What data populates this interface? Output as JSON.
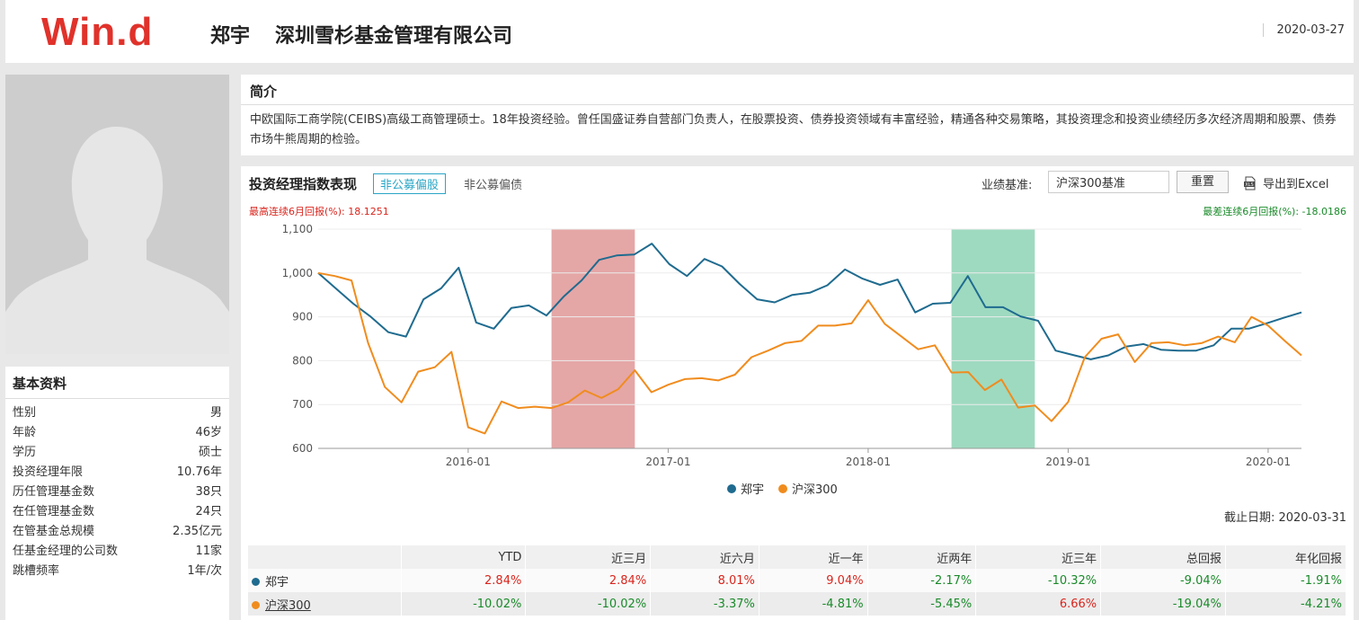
{
  "header": {
    "logo": "Win.d",
    "manager": "郑宇",
    "company": "深圳雪杉基金管理有限公司",
    "date": "2020-03-27"
  },
  "basic": {
    "title": "基本资料",
    "rows": [
      {
        "label": "性别",
        "value": "男"
      },
      {
        "label": "年龄",
        "value": "46岁"
      },
      {
        "label": "学历",
        "value": "硕士"
      },
      {
        "label": "投资经理年限",
        "value": "10.76年"
      },
      {
        "label": "历任管理基金数",
        "value": "38只"
      },
      {
        "label": "在任管理基金数",
        "value": "24只"
      },
      {
        "label": "在管基金总规模",
        "value": "2.35亿元"
      },
      {
        "label": "任基金经理的公司数",
        "value": "11家"
      },
      {
        "label": "跳槽频率",
        "value": "1年/次"
      }
    ]
  },
  "intro": {
    "title": "简介",
    "text": "中欧国际工商学院(CEIBS)高级工商管理硕士。18年投资经验。曾任国盛证券自营部门负责人，在股票投资、债券投资领域有丰富经验，精通各种交易策略，其投资理念和投资业绩经历多次经济周期和股票、债券市场牛熊周期的检验。"
  },
  "perf": {
    "title": "投资经理指数表现",
    "tab_active": "非公募偏股",
    "tab": "非公募偏债",
    "bench_label": "业绩基准:",
    "bench_value": "沪深300基准",
    "reset": "重置",
    "export": "导出到Excel",
    "max_label": "最高连续6月回报(%):  18.1251",
    "min_label": "最差连续6月回报(%):  -18.0186",
    "cutoff": "截止日期:  2020-03-31"
  },
  "chart_data": {
    "type": "line",
    "ylim": [
      600,
      1100
    ],
    "y_ticks": [
      "600",
      "700",
      "800",
      "900",
      "1,000",
      "1,100"
    ],
    "x_ticks": [
      "2016-01",
      "2017-01",
      "2018-01",
      "2019-01",
      "2020-01"
    ],
    "x_range": [
      "2015-04",
      "2020-03"
    ],
    "highlight_best": [
      "2016-06",
      "2016-11"
    ],
    "highlight_worst": [
      "2018-06",
      "2018-11"
    ],
    "colors": {
      "manager": "#1f6b8f",
      "benchmark": "#f08c1e",
      "best": "#d36a6a",
      "worst": "#4ebc8c"
    },
    "legend": [
      "郑宇",
      "沪深300"
    ],
    "series": [
      {
        "name": "郑宇",
        "values": [
          1000,
          965,
          930,
          900,
          865,
          855,
          940,
          965,
          1012,
          887,
          873,
          920,
          926,
          903,
          947,
          983,
          1030,
          1040,
          1042,
          1067,
          1020,
          993,
          1032,
          1015,
          975,
          940,
          933,
          950,
          955,
          972,
          1008,
          987,
          973,
          985,
          910,
          930,
          932,
          993,
          922,
          922,
          901,
          891,
          823,
          813,
          803,
          812,
          832,
          838,
          825,
          823,
          823,
          835,
          873,
          873,
          885,
          898,
          910
        ]
      },
      {
        "name": "沪深300",
        "values": [
          1000,
          993,
          983,
          840,
          740,
          705,
          775,
          785,
          820,
          648,
          634,
          707,
          692,
          695,
          692,
          705,
          732,
          715,
          735,
          778,
          728,
          745,
          758,
          760,
          755,
          768,
          808,
          823,
          840,
          845,
          880,
          880,
          885,
          938,
          884,
          855,
          826,
          835,
          773,
          774,
          733,
          757,
          693,
          698,
          662,
          706,
          808,
          850,
          860,
          797,
          840,
          842,
          835,
          840,
          855,
          842,
          900,
          880,
          845,
          812
        ]
      }
    ]
  },
  "table": {
    "headers": [
      "",
      "YTD",
      "近三月",
      "近六月",
      "近一年",
      "近两年",
      "近三年",
      "总回报",
      "年化回报"
    ],
    "rows": [
      {
        "name": "郑宇",
        "values": [
          "2.84%",
          "2.84%",
          "8.01%",
          "9.04%",
          "-2.17%",
          "-10.32%",
          "-9.04%",
          "-1.91%"
        ]
      },
      {
        "name": "沪深300",
        "values": [
          "-10.02%",
          "-10.02%",
          "-3.37%",
          "-4.81%",
          "-5.45%",
          "6.66%",
          "-19.04%",
          "-4.21%"
        ]
      }
    ]
  }
}
